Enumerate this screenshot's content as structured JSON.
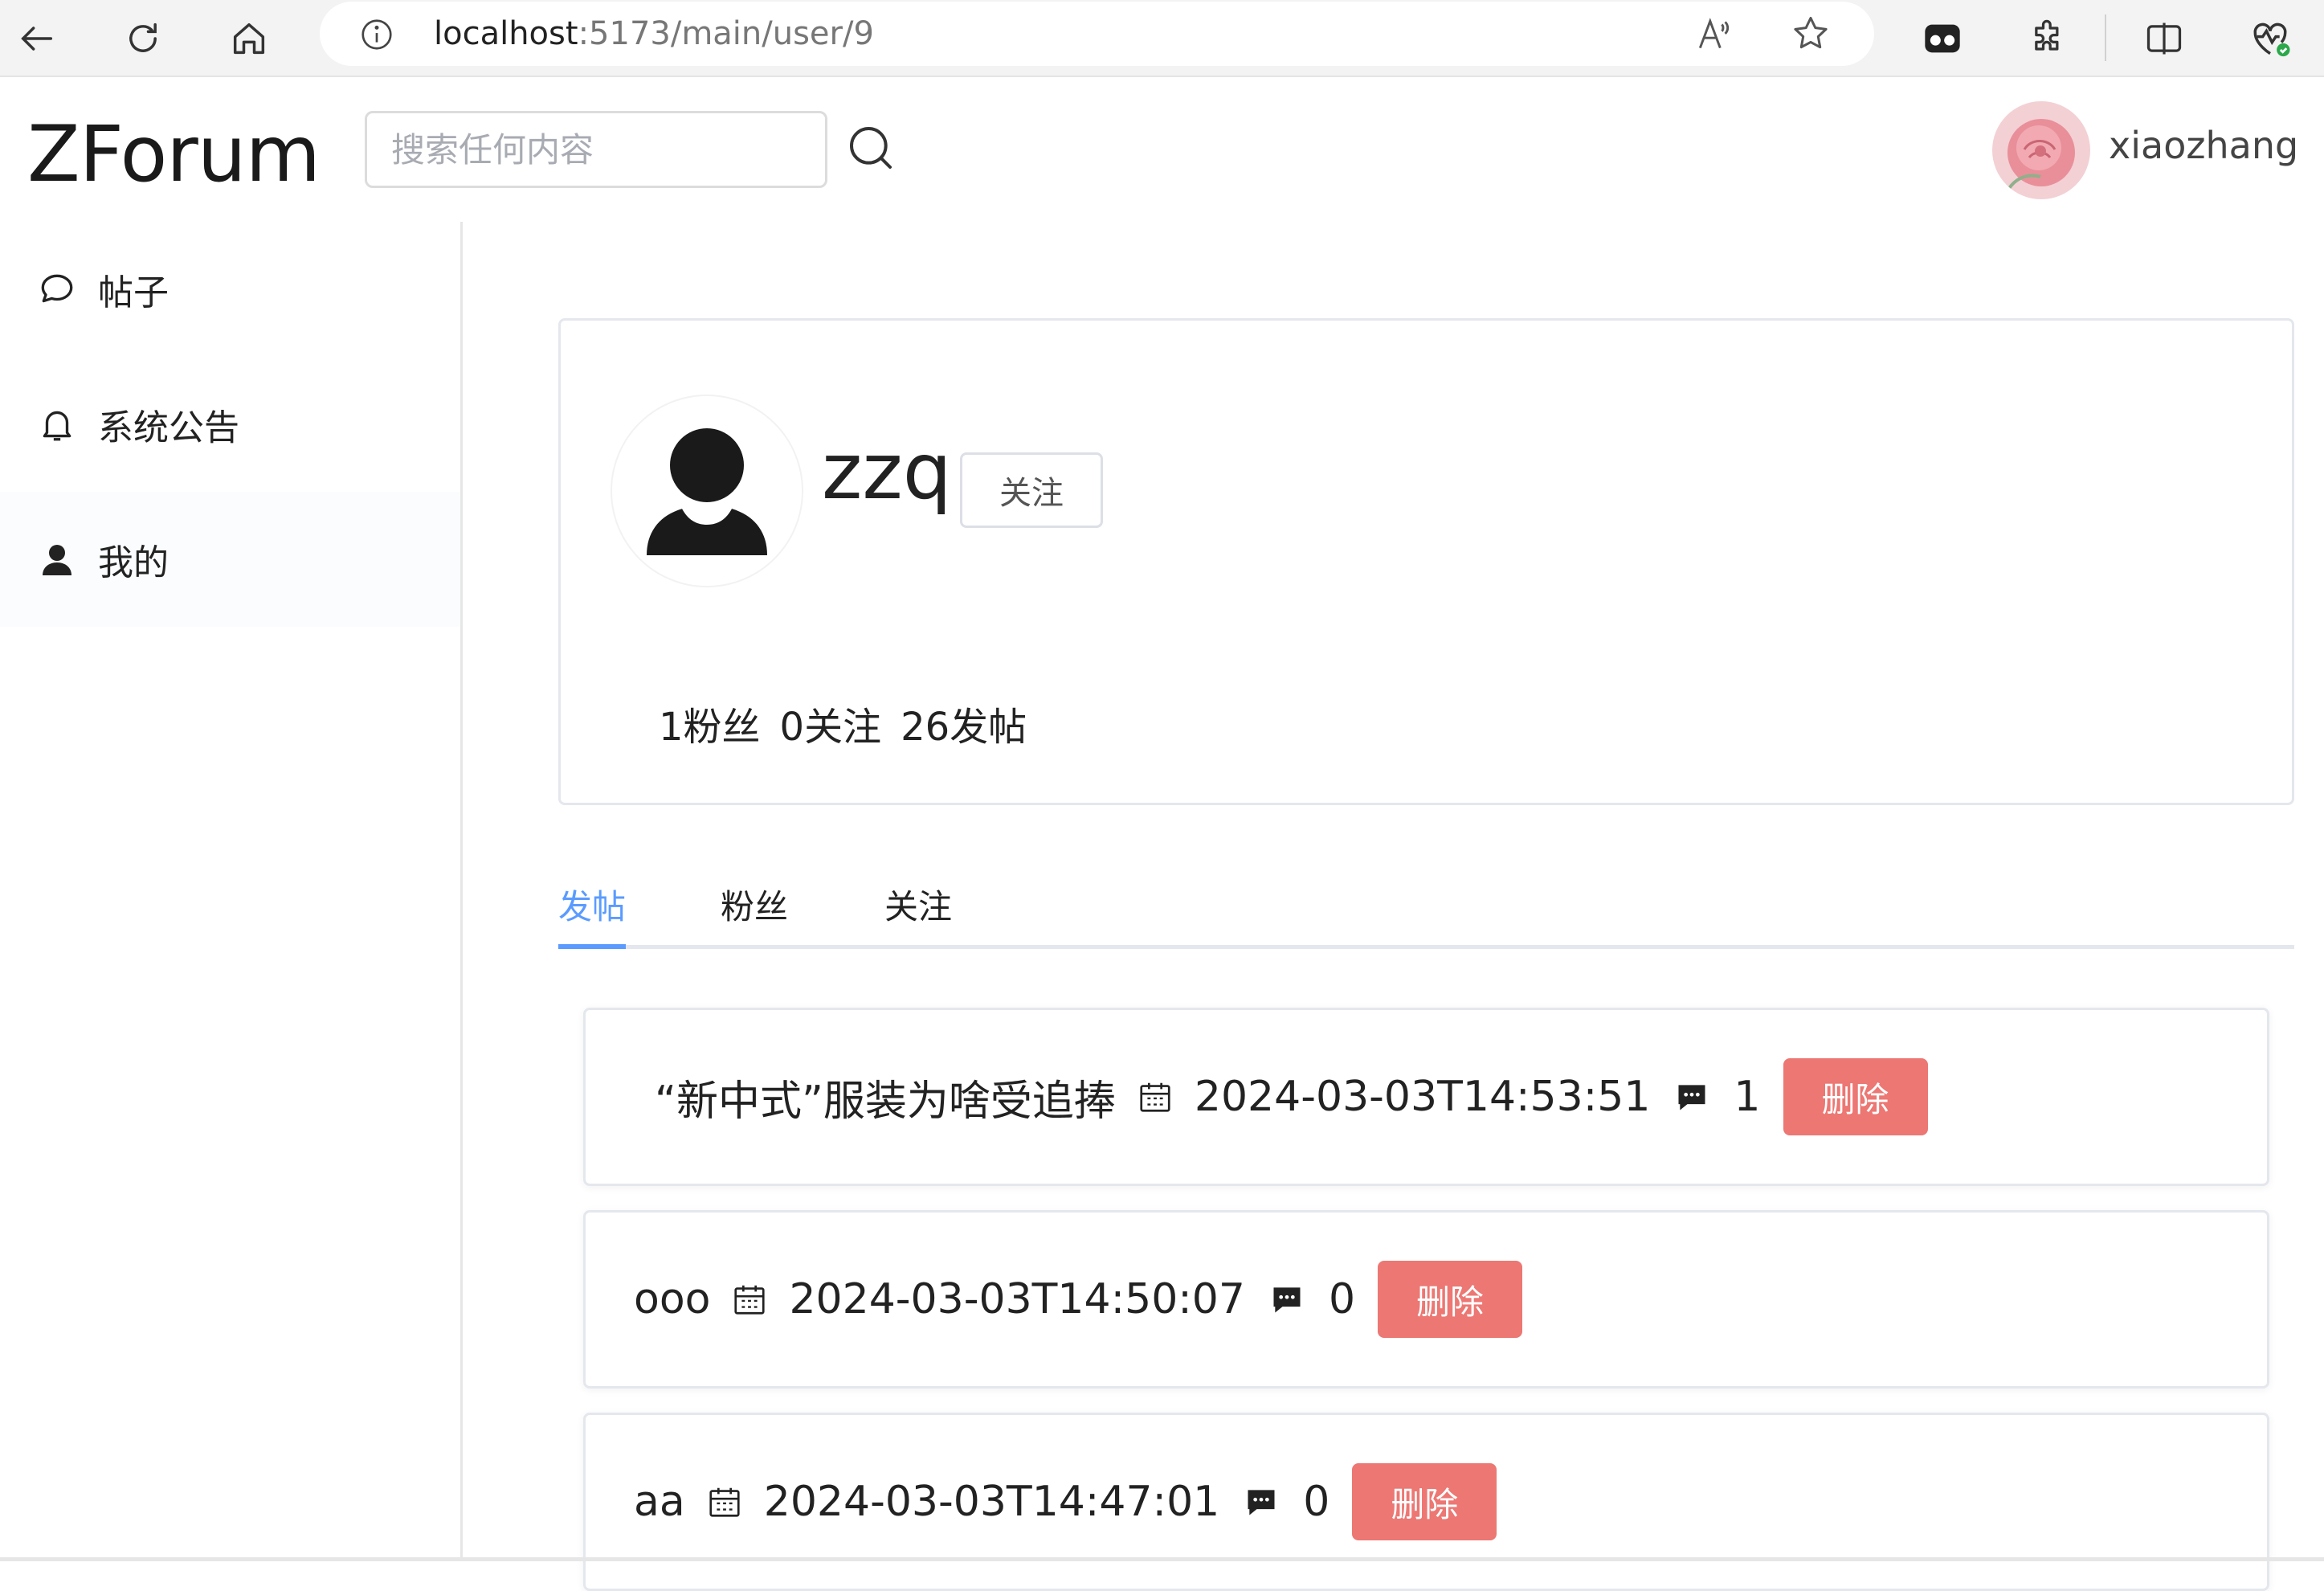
{
  "browser": {
    "url_host": "localhost",
    "url_path": ":5173/main/user/9"
  },
  "header": {
    "logo": "ZForum",
    "search_placeholder": "搜索任何内容",
    "username": "xiaozhang"
  },
  "sidebar": {
    "items": [
      {
        "label": "帖子",
        "icon": "chat-bubble-icon"
      },
      {
        "label": "系统公告",
        "icon": "bell-icon"
      },
      {
        "label": "我的",
        "icon": "user-icon"
      }
    ]
  },
  "profile": {
    "name": "zzq",
    "follow_label": "关注",
    "stats": {
      "followers": "1粉丝",
      "following": "0关注",
      "posts": "26发帖"
    }
  },
  "tabs": [
    "发帖",
    "粉丝",
    "关注"
  ],
  "posts": [
    {
      "title": "“新中式”服装为啥受追捧",
      "date": "2024-03-03T14:53:51",
      "comments": "1",
      "delete_label": "删除"
    },
    {
      "title": "ooo",
      "date": "2024-03-03T14:50:07",
      "comments": "0",
      "delete_label": "删除"
    },
    {
      "title": "aa",
      "date": "2024-03-03T14:47:01",
      "comments": "0",
      "delete_label": "删除"
    }
  ],
  "colors": {
    "accent": "#5b9bff",
    "danger": "#ec7773"
  }
}
